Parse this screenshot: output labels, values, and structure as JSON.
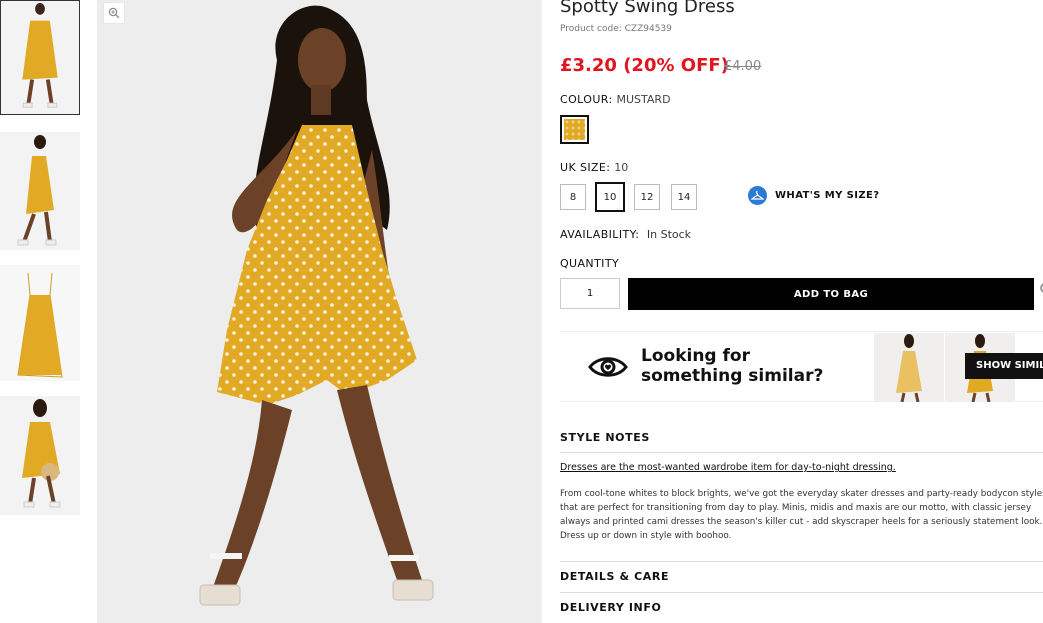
{
  "product": {
    "title": "Spotty Swing Dress",
    "code": "Product code: CZZ94539",
    "price": "£3.20 (20% OFF)",
    "was_price": "£4.00"
  },
  "colour": {
    "label": "COLOUR:",
    "value": "MUSTARD",
    "swatch_color": "#e2aa24"
  },
  "size": {
    "label": "UK SIZE:",
    "value": "10",
    "options": [
      "8",
      "10",
      "12",
      "14"
    ],
    "selected": "10",
    "guide_label": "WHAT'S MY SIZE?"
  },
  "availability": {
    "label": "AVAILABILITY:",
    "value": "In Stock"
  },
  "quantity": {
    "label": "QUANTITY",
    "value": "1"
  },
  "buttons": {
    "add_to_bag": "ADD TO BAG",
    "show_similar": "SHOW SIMILA"
  },
  "similar": {
    "line1": "Looking for",
    "line2": "something similar?"
  },
  "sections": {
    "style_notes": "STYLE NOTES",
    "details_care": "DETAILS & CARE",
    "delivery_info": "DELIVERY INFO"
  },
  "description": {
    "headline": "Dresses are the most-wanted wardrobe item for day-to-night dressing.",
    "body": "From cool-tone whites to block brights, we've got the everyday skater dresses and party-ready bodycon styles that are perfect for transitioning from day to play. Minis, midis and maxis are our motto, with classic jersey always and printed cami dresses the season's killer cut - add skyscraper heels for a seriously statement look. Dress up or down in style with boohoo."
  },
  "colors": {
    "sale_red": "#e0151f",
    "mustard": "#e2aa24",
    "black": "#000000"
  }
}
